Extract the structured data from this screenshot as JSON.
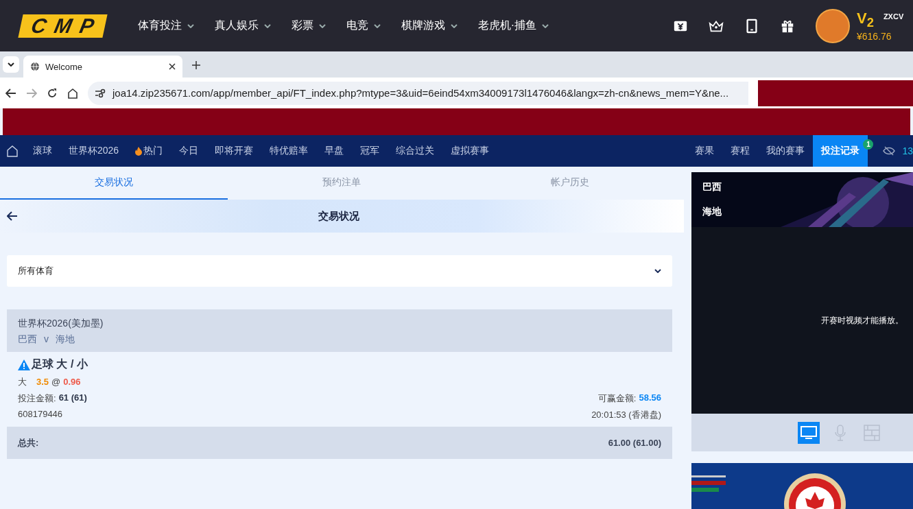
{
  "site_header": {
    "logo": "CMP",
    "menu": [
      {
        "label": "体育投注"
      },
      {
        "label": "真人娱乐"
      },
      {
        "label": "彩票"
      },
      {
        "label": "电竞"
      },
      {
        "label": "棋牌游戏"
      },
      {
        "label": "老虎机·捕鱼"
      }
    ],
    "tools": [
      {
        "kind": "ticket"
      },
      {
        "kind": "crown"
      },
      {
        "kind": "tablet"
      },
      {
        "kind": "gift"
      }
    ],
    "user": {
      "level": "V$_{2}$",
      "balance": "¥616.76",
      "name": "ZXCV"
    }
  },
  "browser": {
    "tab_title": "Welcome",
    "url": "joa14.zip235671.com/app/member_api/FT_index.php?mtype=3&uid=6eind54xm34009173l1476046&langx=zh-cn&news_mem=Y&ne..."
  },
  "nav": {
    "items": [
      {
        "label": "滚球",
        "hot": false
      },
      {
        "label": "世界杯2026",
        "hot": false
      },
      {
        "label": "热门",
        "hot": true
      },
      {
        "label": "今日",
        "hot": false
      },
      {
        "label": "即将开赛",
        "hot": false
      },
      {
        "label": "特优赔率",
        "hot": false
      },
      {
        "label": "早盘",
        "hot": false
      },
      {
        "label": "冠军",
        "hot": false
      },
      {
        "label": "综合过关",
        "hot": false
      },
      {
        "label": "虚拟赛事",
        "hot": false
      }
    ],
    "right_items": [
      {
        "label": "赛果",
        "selected": false
      },
      {
        "label": "赛程",
        "selected": false
      },
      {
        "label": "我的赛事",
        "selected": false
      },
      {
        "label": "投注记录",
        "selected": true,
        "badge": "1"
      }
    ],
    "count": "13"
  },
  "tabs": [
    {
      "label": "交易状况",
      "selected": true
    },
    {
      "label": "预约注单",
      "selected": false
    },
    {
      "label": "帐户历史",
      "selected": false
    }
  ],
  "page_title": "交易状况",
  "filter": {
    "value": "所有体育"
  },
  "bet": {
    "league": "世界杯2026(美加墨)",
    "home": "巴西",
    "vs": "v",
    "away": "海地",
    "market": "足球 大 / 小",
    "selection": "大",
    "line": "3.5",
    "at": "@",
    "odds": "0.96",
    "stake_label": "投注金额:",
    "stake": "61 (61)",
    "win_label": "可赢金额:",
    "win": "58.56",
    "ticket_id": "608179446",
    "time": "20:01:53 (香港盘)"
  },
  "total": {
    "label": "总共:",
    "value": "61.00 (61.00)"
  },
  "video": {
    "home": "巴西",
    "away": "海地",
    "message": "开赛时视频才能播放。",
    "controls": [
      {
        "kind": "tv",
        "selected": true
      },
      {
        "kind": "mic",
        "selected": false
      },
      {
        "kind": "layout",
        "selected": false
      }
    ]
  }
}
